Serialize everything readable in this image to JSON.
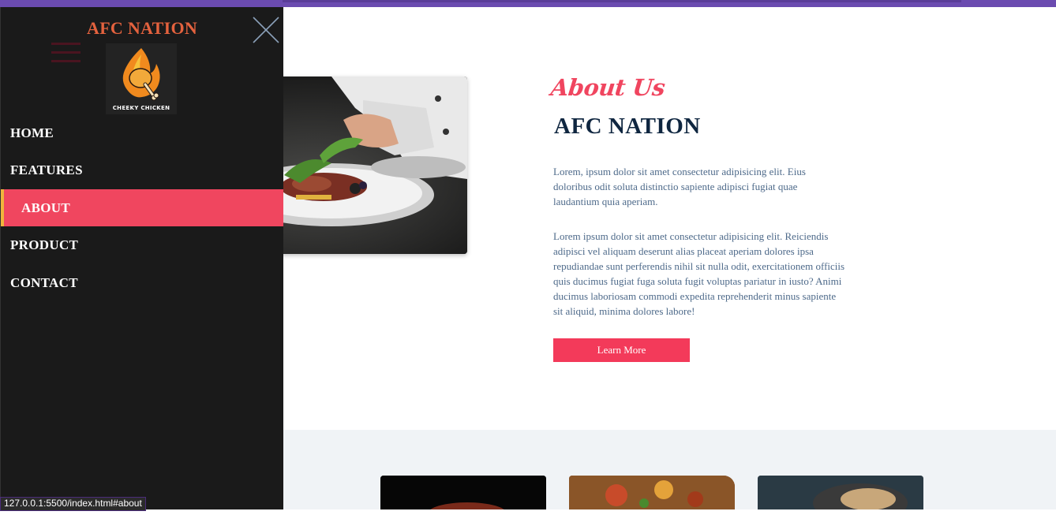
{
  "sidebar": {
    "brand": "AFC NATION",
    "logo_text": "CHEEKY CHICKEN",
    "nav": [
      {
        "label": "HOME"
      },
      {
        "label": "FEATURES"
      },
      {
        "label": "ABOUT",
        "active": true
      },
      {
        "label": "PRODUCT"
      },
      {
        "label": "CONTACT"
      }
    ],
    "close_icon": "close-icon",
    "menu_icon": "hamburger-icon"
  },
  "about": {
    "script_heading": "About Us",
    "title": "AFC NATION",
    "paragraph1": "Lorem, ipsum dolor sit amet consectetur adipisicing elit. Eius doloribus odit soluta distinctio sapiente adipisci fugiat quae laudantium quia aperiam.",
    "paragraph2": "Lorem ipsum dolor sit amet consectetur adipisicing elit. Reiciendis adipisci vel aliquam deserunt alias placeat aperiam dolores ipsa repudiandae sunt perferendis nihil sit nulla odit, exercitationem officiis quis ducimus fugiat fuga soluta fugit voluptas pariatur in iusto? Animi ducimus laboriosam commodi expedita reprehenderit minus sapiente sit aliquid, minima dolores labore!",
    "button_label": "Learn More"
  },
  "status_url": "127.0.0.1:5500/index.html#about",
  "colors": {
    "accent": "#f0465f",
    "active_border": "#f0b43c",
    "brand": "#e4623e",
    "title": "#0f2640",
    "sidebar_bg": "#1a1a1a"
  }
}
